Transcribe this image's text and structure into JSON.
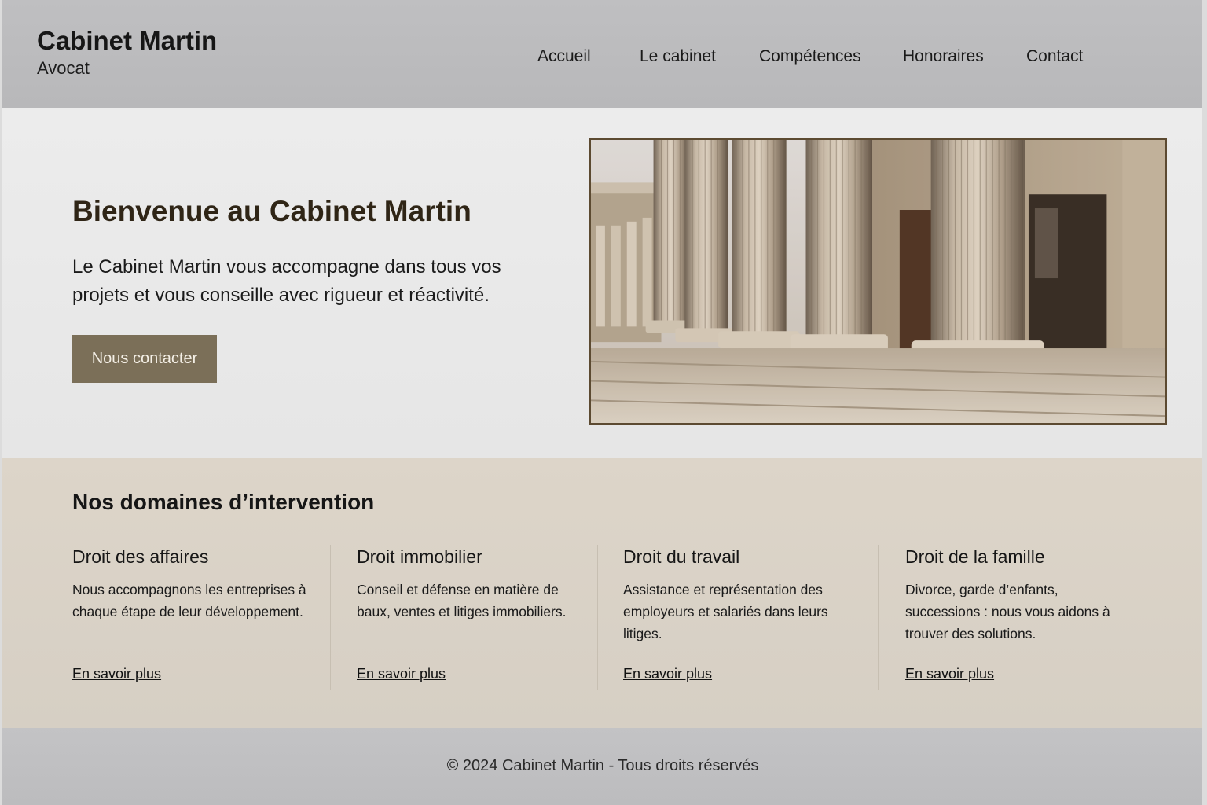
{
  "site": {
    "title": "Cabinet Martin",
    "subtitle": "Avocat"
  },
  "nav": {
    "items": [
      {
        "label": "Accueil"
      },
      {
        "label": "Le cabinet"
      },
      {
        "label": "Compétences"
      },
      {
        "label": "Honoraires"
      },
      {
        "label": "Contact"
      }
    ]
  },
  "hero": {
    "title": "Bienvenue au Cabinet Martin",
    "text": "Le Cabinet Martin vous accompagne dans tous vos projets et vous conseille avec rigueur et réactivité.",
    "button_label": "Nous contacter",
    "image_icon": "courthouse-columns-photo"
  },
  "domains": {
    "title": "Nos domaines d’intervention",
    "cards": [
      {
        "title": "Droit des affaires",
        "text": "Nous accompagnons les entreprises à chaque étape de leur développement.",
        "link": "En savoir plus"
      },
      {
        "title": "Droit immobilier",
        "text": "Conseil et défense en matière de baux, ventes et litiges immobiliers.",
        "link": "En savoir plus"
      },
      {
        "title": "Droit du travail",
        "text": "Assistance et représentation des employeurs et salariés dans leurs litiges.",
        "link": "En savoir plus"
      },
      {
        "title": "Droit de la famille",
        "text": "Divorce, garde d’enfants, successions : nous vous aidons à trouver des solutions.",
        "link": "En savoir plus"
      }
    ]
  },
  "footer": {
    "text": "© 2024 Cabinet Martin - Tous droits réservés"
  },
  "colors": {
    "accent": "#7b6f58",
    "hero_title": "#2f2516",
    "domains_bg": "#ddd5c9",
    "header_bg": "#bfbfc1"
  }
}
